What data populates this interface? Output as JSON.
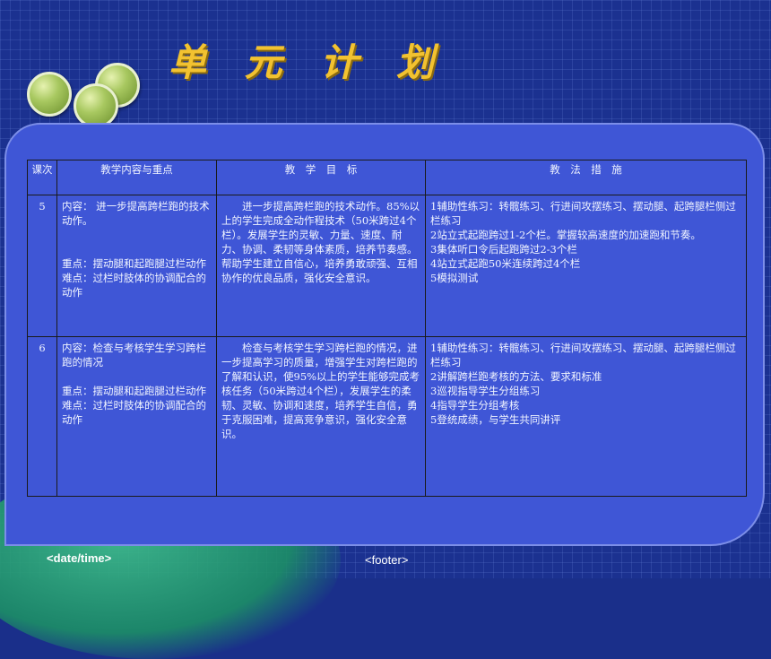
{
  "slide": {
    "title": "单 元 计 划",
    "footer_date": "<date/time>",
    "footer": "<footer>"
  },
  "table": {
    "headers": [
      "课次",
      "教学内容与重点",
      "教　学　目　标",
      "教　法　措　施"
    ],
    "rows": [
      {
        "num": "5",
        "content": {
          "content_line": "内容： 进一步提高跨栏跑的技术动作。",
          "focus": "重点：摆动腿和起跑腿过栏动作",
          "difficulty": "难点：过栏时肢体的协调配合的动作"
        },
        "goal": "进一步提高跨栏跑的技术动作。85%以上的学生完成全动作程技术（50米跨过4个栏）。发展学生的灵敏、力量、速度、耐力、协调、柔韧等身体素质，培养节奏感。帮助学生建立自信心，培养勇敢顽强、互相协作的优良品质，强化安全意识。",
        "methods": [
          "1辅助性练习：转髋练习、行进间攻摆练习、摆动腿、起跨腿栏侧过栏练习",
          "2站立式起跑跨过1-2个栏。掌握较高速度的加速跑和节奏。",
          "3集体听口令后起跑跨过2-3个栏",
          "4站立式起跑50米连续跨过4个栏",
          "5模拟测试"
        ]
      },
      {
        "num": "6",
        "content": {
          "content_line": "内容：检查与考核学生学习跨栏跑的情况",
          "focus": "重点：摆动腿和起跑腿过栏动作",
          "difficulty": "难点：过栏时肢体的协调配合的动作"
        },
        "goal": "检查与考核学生学习跨栏跑的情况，进一步提高学习的质量，增强学生对跨栏跑的了解和认识，使95%以上的学生能够完成考核任务（50米跨过4个栏），发展学生的柔韧、灵敏、协调和速度，培养学生自信，勇于克服困难，提高竞争意识，强化安全意识。",
        "methods": [
          "1辅助性练习：转髋练习、行进间攻摆练习、摆动腿、起跨腿栏侧过栏练习",
          "2讲解跨栏跑考核的方法、要求和标准",
          "3巡视指导学生分组练习",
          "4指导学生分组考核",
          "5登统成绩，与学生共同讲评"
        ]
      }
    ]
  }
}
